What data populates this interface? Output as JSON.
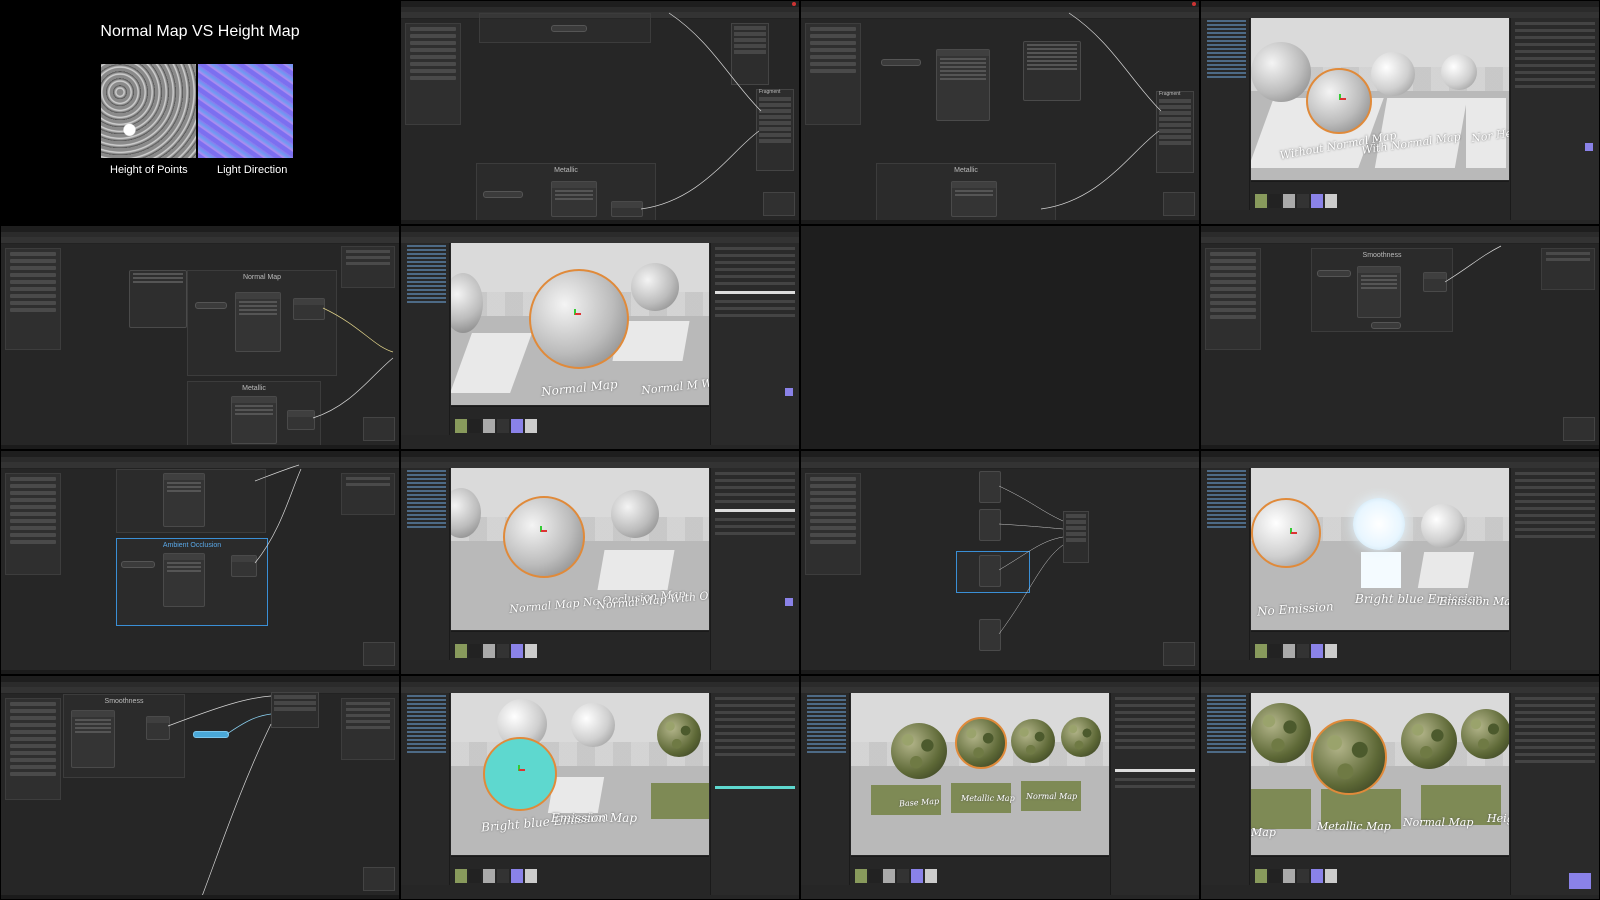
{
  "slide": {
    "title": "Normal Map VS Height Map",
    "caption_left": "Height of Points",
    "caption_right": "Light Direction"
  },
  "shader_graph": {
    "metallic_group": "Metallic",
    "normal_map_group": "Normal Map",
    "smoothness_group": "Smoothness",
    "ambient_occlusion_group": "Ambient Occlusion",
    "fragment_label": "Fragment"
  },
  "scene_labels": {
    "t4": [
      "Without Normal Map",
      "With Normal Map",
      "Nor Hei"
    ],
    "t6": [
      "Normal Map",
      "Normal M With Heig"
    ],
    "t10": [
      "Normal Map No Occlusion Map",
      "Normal Map With Occlusion Map"
    ],
    "t12": [
      "No Emission",
      "Bright blue Emission",
      "Emission Map"
    ],
    "t14": [
      "Bright blue Emission",
      "Emission Map"
    ],
    "t15": [
      "Base Map",
      "Metallic Map",
      "Normal Map"
    ],
    "t16": [
      "Map",
      "Metallic Map",
      "Normal Map",
      "Heig"
    ]
  },
  "colors": {
    "selection_outline": "#e08a3a",
    "group_selected": "#3a8fd6",
    "emission_teal": "#5ed8cf",
    "normal_map_purple": "#8a82e8"
  }
}
